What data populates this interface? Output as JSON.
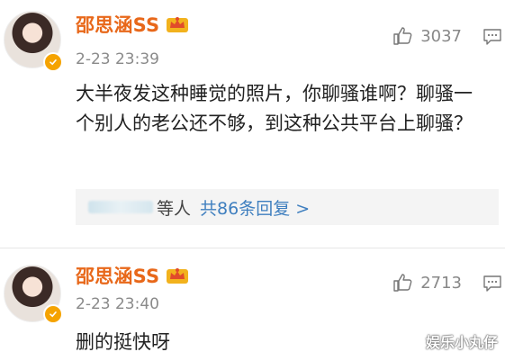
{
  "comments": [
    {
      "username": "邵思涵SS",
      "timestamp": "2-23 23:39",
      "like_count": "3037",
      "text": "大半夜发这种睡觉的照片，你聊骚谁啊？聊骚一个别人的老公还不够，到这种公共平台上聊骚？",
      "replies": {
        "people_suffix": "等人",
        "count_text": "共86条回复 >"
      }
    },
    {
      "username": "邵思涵SS",
      "timestamp": "2-23 23:40",
      "like_count": "2713",
      "text": "删的挺快呀"
    }
  ],
  "watermark": "娱乐小丸仔",
  "colors": {
    "username": "#e8681a",
    "reply_link": "#3f7fbf",
    "verified_badge": "#f5a300",
    "meta_text": "#8a8a8a"
  },
  "icons": {
    "like": "thumbs-up-icon",
    "reply": "comment-icon",
    "verified": "verified-badge-icon",
    "member": "crown-vip-icon"
  }
}
